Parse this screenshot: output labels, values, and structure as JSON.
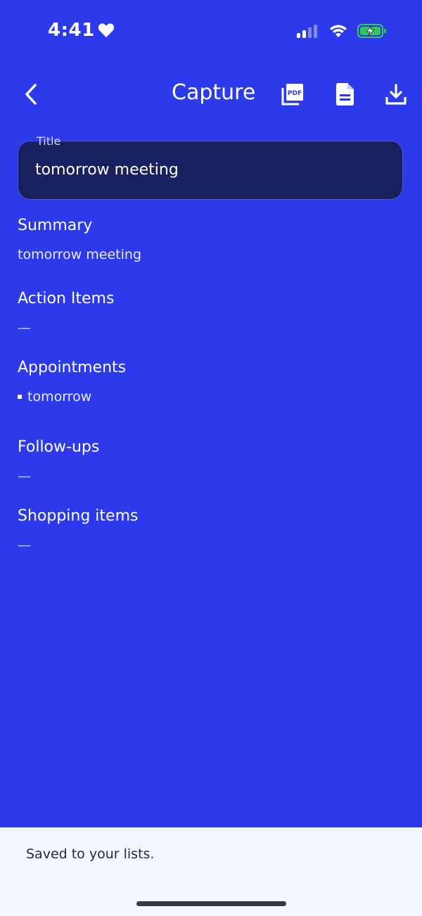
{
  "status_bar": {
    "time": "4:41"
  },
  "header": {
    "title": "Capture"
  },
  "title_field": {
    "label": "Title",
    "value": "tomorrow meeting"
  },
  "sections": {
    "summary": {
      "heading": "Summary",
      "text": "tomorrow meeting"
    },
    "action_items": {
      "heading": "Action Items",
      "empty": "—"
    },
    "appointments": {
      "heading": "Appointments",
      "items": [
        "tomorrow"
      ]
    },
    "follow_ups": {
      "heading": "Follow-ups",
      "empty": "—"
    },
    "shopping_items": {
      "heading": "Shopping items",
      "empty": "—"
    }
  },
  "toast": {
    "message": "Saved to your lists."
  },
  "colors": {
    "background": "#2d3aec",
    "field_background": "#18215f",
    "toast_background": "#f5f7fe",
    "battery_green": "#34c759"
  }
}
